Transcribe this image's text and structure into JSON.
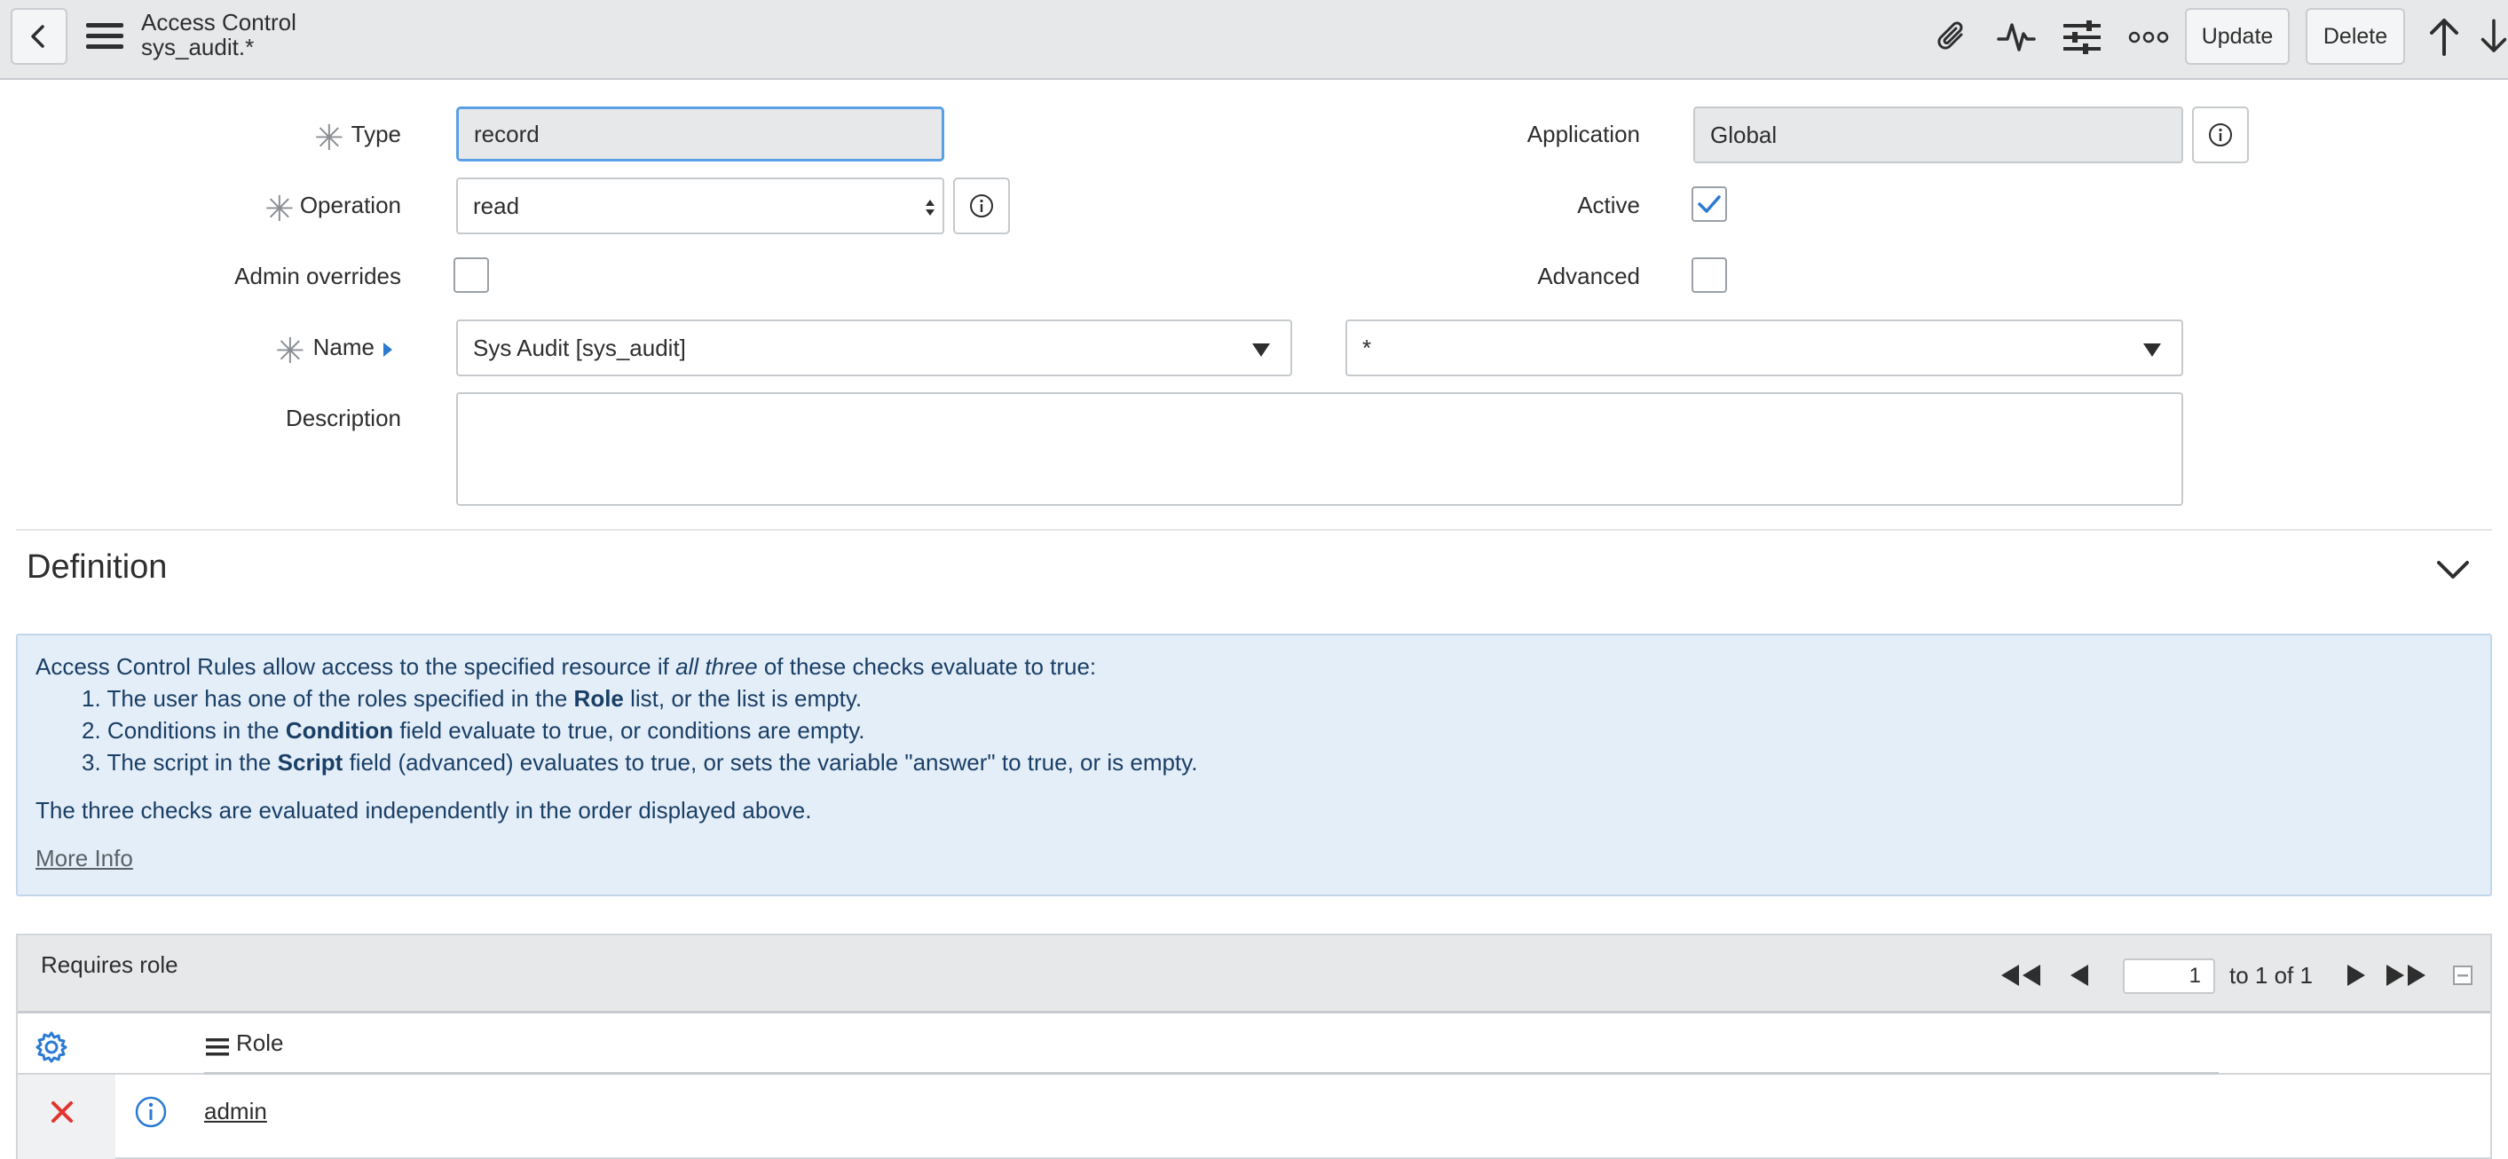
{
  "header": {
    "title": "Access Control",
    "subtitle": "sys_audit.*",
    "update_label": "Update",
    "delete_label": "Delete"
  },
  "form": {
    "type_label": "Type",
    "type_value": "record",
    "operation_label": "Operation",
    "operation_value": "read",
    "admin_overrides_label": "Admin overrides",
    "admin_overrides_checked": false,
    "name_label": "Name",
    "name_table_value": "Sys Audit [sys_audit]",
    "name_field_value": "*",
    "description_label": "Description",
    "description_value": "",
    "application_label": "Application",
    "application_value": "Global",
    "active_label": "Active",
    "active_checked": true,
    "advanced_label": "Advanced",
    "advanced_checked": false
  },
  "definition": {
    "title": "Definition",
    "intro_pre": "Access Control Rules allow access to the specified resource if ",
    "intro_em": "all three",
    "intro_post": " of these checks evaluate to true:",
    "items": [
      {
        "num": "1.",
        "pre": "The user has one of the roles specified in the ",
        "bold": "Role",
        "post": " list, or the list is empty."
      },
      {
        "num": "2.",
        "pre": "Conditions in the ",
        "bold": "Condition",
        "post": " field evaluate to true, or conditions are empty."
      },
      {
        "num": "3.",
        "pre": "The script in the ",
        "bold": "Script",
        "post": " field (advanced) evaluates to true, or sets the variable \"answer\" to true, or is empty."
      }
    ],
    "footer": "The three checks are evaluated independently in the order displayed above.",
    "more_info": "More Info"
  },
  "related": {
    "title": "Requires role",
    "page_value": "1",
    "page_text": "to 1 of 1",
    "column_role": "Role",
    "rows": [
      {
        "role": "admin"
      }
    ]
  },
  "colors": {
    "accent": "#2b7bd3",
    "delete_red": "#e3342f",
    "info_bg": "#e4eef8"
  }
}
